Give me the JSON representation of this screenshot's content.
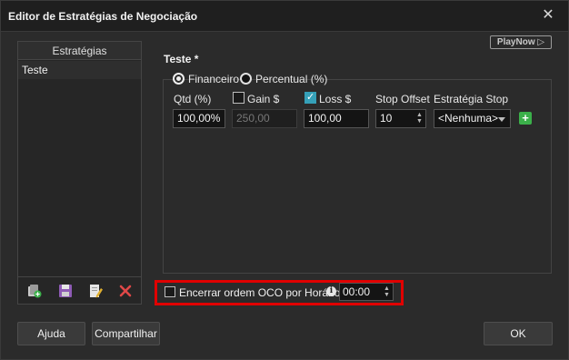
{
  "window": {
    "title": "Editor de Estratégias de Negociação",
    "close_glyph": "✕"
  },
  "sidebar": {
    "header": "Estratégias",
    "items": [
      {
        "label": "Teste"
      }
    ],
    "toolbar": [
      "add-strategy-icon",
      "save-icon",
      "edit-icon",
      "delete-icon"
    ]
  },
  "playnow": {
    "label": "PlayNow ▷"
  },
  "strategy": {
    "name": "Teste *",
    "mode_options": [
      "Financeiro",
      "Percentual (%)"
    ],
    "mode_selected": "Financeiro",
    "columns": {
      "qtd": "Qtd (%)",
      "gain": "Gain $",
      "loss": "Loss $",
      "stop_offset": "Stop Offset",
      "stop_strategy": "Estratégia Stop"
    },
    "values": {
      "qtd": "100,00%",
      "gain": "250,00",
      "gain_checked": false,
      "loss": "100,00",
      "loss_checked": true,
      "stop_offset": "10",
      "stop_strategy": "<Nenhuma>"
    },
    "add_glyph": "+"
  },
  "oco": {
    "label": "Encerrar ordem OCO por Horário",
    "checked": false,
    "time": "00:00",
    "info_glyph": "i"
  },
  "buttons": {
    "help": "Ajuda",
    "share": "Compartilhar",
    "ok": "OK"
  },
  "colors": {
    "accent": "#35a0b8",
    "add": "#3bb04a",
    "highlight": "#e00000"
  }
}
